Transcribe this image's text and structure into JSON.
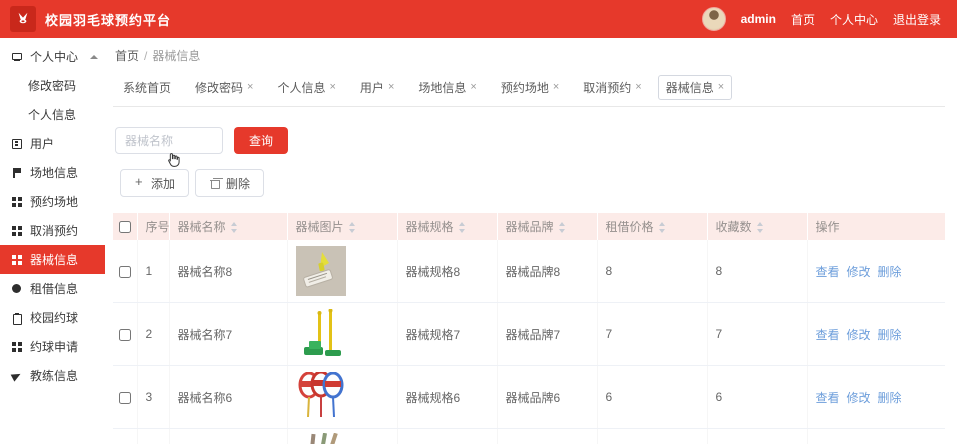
{
  "app": {
    "title": "校园羽毛球预约平台"
  },
  "header": {
    "username": "admin",
    "nav_home": "首页",
    "nav_profile": "个人中心",
    "nav_logout": "退出登录"
  },
  "sidebar": {
    "items": [
      {
        "label": "个人中心",
        "icon": "monitor-icon",
        "expanded": true
      },
      {
        "label": "修改密码",
        "sub": true
      },
      {
        "label": "个人信息",
        "sub": true
      },
      {
        "label": "用户",
        "icon": "user-icon"
      },
      {
        "label": "场地信息",
        "icon": "flag-icon"
      },
      {
        "label": "预约场地",
        "icon": "grid-icon"
      },
      {
        "label": "取消预约",
        "icon": "grid-icon"
      },
      {
        "label": "器械信息",
        "icon": "grid-icon",
        "active": true
      },
      {
        "label": "租借信息",
        "icon": "ball-icon"
      },
      {
        "label": "校园约球",
        "icon": "clipboard-icon"
      },
      {
        "label": "约球申请",
        "icon": "grid-icon"
      },
      {
        "label": "教练信息",
        "icon": "plane-icon"
      }
    ]
  },
  "breadcrumb": {
    "home": "首页",
    "separator": "/",
    "current": "器械信息"
  },
  "tabs": [
    {
      "label": "系统首页",
      "closable": false
    },
    {
      "label": "修改密码",
      "closable": true
    },
    {
      "label": "个人信息",
      "closable": true
    },
    {
      "label": "用户",
      "closable": true
    },
    {
      "label": "场地信息",
      "closable": true
    },
    {
      "label": "预约场地",
      "closable": true
    },
    {
      "label": "取消预约",
      "closable": true
    },
    {
      "label": "器械信息",
      "closable": true,
      "active": true
    }
  ],
  "toolbar": {
    "search_placeholder": "器械名称",
    "search_button": "查询",
    "add_button": "添加",
    "delete_button": "删除"
  },
  "table": {
    "columns": {
      "no": "序号",
      "name": "器械名称",
      "image": "器械图片",
      "spec": "器械规格",
      "brand": "器械品牌",
      "price": "租借价格",
      "favorites": "收藏数",
      "actions": "操作"
    },
    "rows": [
      {
        "no": "1",
        "name": "器械名称8",
        "image": "shuttlecock-tube-photo",
        "spec": "器械规格8",
        "brand": "器械品牌8",
        "price": "8",
        "favorites": "8"
      },
      {
        "no": "2",
        "name": "器械名称7",
        "image": "net-post-photo",
        "spec": "器械规格7",
        "brand": "器械品牌7",
        "price": "7",
        "favorites": "7"
      },
      {
        "no": "3",
        "name": "器械名称6",
        "image": "rackets-photo",
        "spec": "器械规格6",
        "brand": "器械品牌6",
        "price": "6",
        "favorites": "6"
      },
      {
        "image": "racket-handles-photo-partial"
      }
    ],
    "actions": {
      "view": "查看",
      "edit": "修改",
      "delete": "删除"
    }
  },
  "colors": {
    "primary": "#e6392b",
    "link": "#6d9edb",
    "table_header_bg": "#fcebe8"
  }
}
